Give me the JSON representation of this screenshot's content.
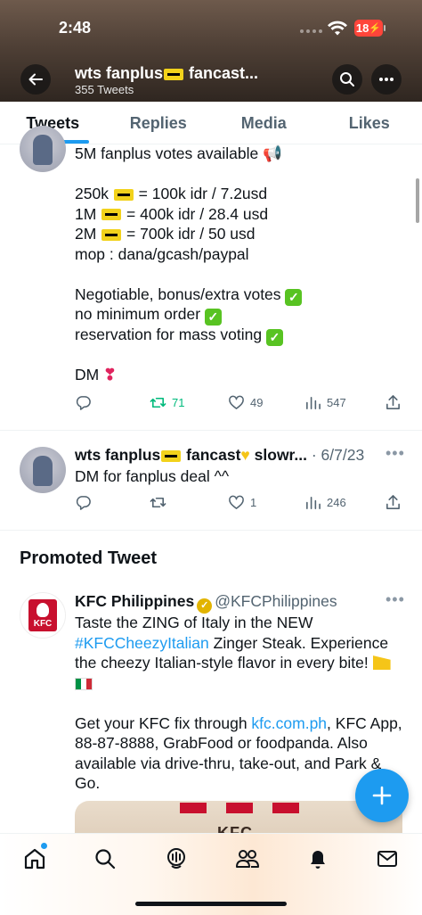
{
  "status_bar": {
    "time": "2:48",
    "battery": "18"
  },
  "header": {
    "name_prefix": "wts fanplus",
    "name_suffix": " fancast...",
    "tweet_count": "355 Tweets"
  },
  "tabs": [
    {
      "label": "Tweets",
      "active": true
    },
    {
      "label": "Replies",
      "active": false
    },
    {
      "label": "Media",
      "active": false
    },
    {
      "label": "Likes",
      "active": false
    }
  ],
  "tweet1": {
    "lines": {
      "l1": "5M fanplus votes available 📢",
      "l2a": "250k ",
      "l2b": " = 100k idr / 7.2usd",
      "l3a": "1M ",
      "l3b": " = 400k idr / 28.4 usd",
      "l4a": "2M ",
      "l4b": " = 700k idr / 50 usd",
      "l5": "mop : dana/gcash/paypal",
      "l6": "Negotiable, bonus/extra votes ",
      "l7": "no minimum order ",
      "l8": "reservation for mass voting ",
      "l9": "DM "
    },
    "exclamation": "❣",
    "retweets": "71",
    "likes": "49",
    "views": "547"
  },
  "tweet2": {
    "name_prefix": "wts fanplus",
    "name_suffix": " fancast",
    "name_tail": " slowr...",
    "date": " · 6/7/23",
    "text": "DM for fanplus deal ^^",
    "likes": "1",
    "views": "246"
  },
  "promoted": {
    "section_title": "Promoted Tweet",
    "name": "KFC Philippines",
    "handle": "@KFCPhilippines",
    "logo_text": "KFC",
    "lines": {
      "l1": "Taste the ZING of Italy in the NEW",
      "l2_link": "#KFCCheezyItalian",
      "l2_rest": " Zinger Steak. Experience",
      "l3": "the cheezy Italian-style flavor in every bite! ",
      "l5a": "Get your KFC fix through ",
      "l5_link": "kfc.com.ph",
      "l5b": ", KFC App,",
      "l6": "88-87-8888, GrabFood or foodpanda. Also",
      "l7": "available via drive-thru, take-out, and Park &",
      "l8": "Go."
    },
    "image_text": "KFC"
  },
  "colors": {
    "accent": "#1d9bf0",
    "retweet_green": "#00ba7c",
    "text_secondary": "#536471",
    "kfc_red": "#c8102e"
  },
  "icons": {
    "back": "arrow-left-icon",
    "search": "search-icon",
    "more": "more-horizontal-icon",
    "reply": "reply-icon",
    "retweet": "retweet-icon",
    "like": "heart-icon",
    "views": "analytics-icon",
    "share": "share-icon",
    "compose": "plus-icon",
    "home": "home-icon",
    "explore": "search-icon",
    "spaces": "spaces-icon",
    "communities": "communities-icon",
    "notifications": "bell-icon",
    "messages": "mail-icon"
  }
}
